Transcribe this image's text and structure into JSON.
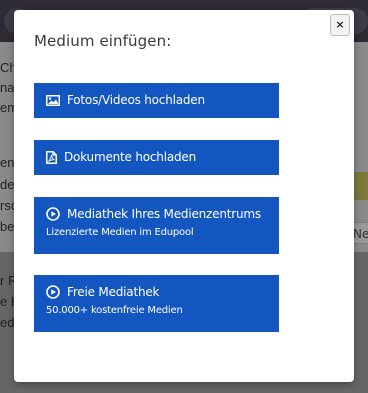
{
  "background": {
    "left_text_fragments": [
      "Ch",
      "na",
      "em",
      "en",
      "de",
      "rsc",
      "be",
      "r R",
      "e K",
      "edi"
    ],
    "chip_text": "Ne"
  },
  "modal": {
    "title": "Medium einfügen:",
    "close_label": "×",
    "buttons": [
      {
        "label": "Fotos/Videos hochladen",
        "icon": "image-icon"
      },
      {
        "label": "Dokumente hochladen",
        "icon": "pdf-file-icon"
      },
      {
        "label": "Mediathek Ihres Medienzentrums",
        "sub": "Lizenzierte Medien im Edupool",
        "icon": "play-circle-icon"
      },
      {
        "label": "Freie Mediathek",
        "sub": "50.000+ kostenfreie Medien",
        "icon": "play-circle-icon"
      }
    ]
  },
  "colors": {
    "button_bg": "#1456c0",
    "backdrop": "#6f6f6f",
    "modal_bg": "#ffffff"
  }
}
